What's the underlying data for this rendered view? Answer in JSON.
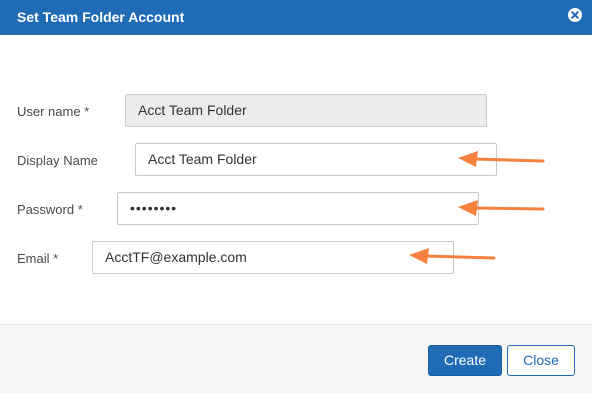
{
  "dialog": {
    "title": "Set Team Folder Account"
  },
  "form": {
    "username": {
      "label": "User name *",
      "value": "Acct Team Folder",
      "disabled": true
    },
    "display_name": {
      "label": "Display Name",
      "value": "Acct Team Folder"
    },
    "password": {
      "label": "Password *",
      "value": "••••••••"
    },
    "email": {
      "label": "Email *",
      "value": "AcctTF@example.com"
    }
  },
  "buttons": {
    "create": "Create",
    "close": "Close"
  },
  "colors": {
    "header": "#1f6bb5",
    "arrow": "#f5813f",
    "footer": "#f7f7f7"
  },
  "icons": {
    "close": "close-circle-icon",
    "annotation_arrow": "orange-arrow-icon"
  }
}
